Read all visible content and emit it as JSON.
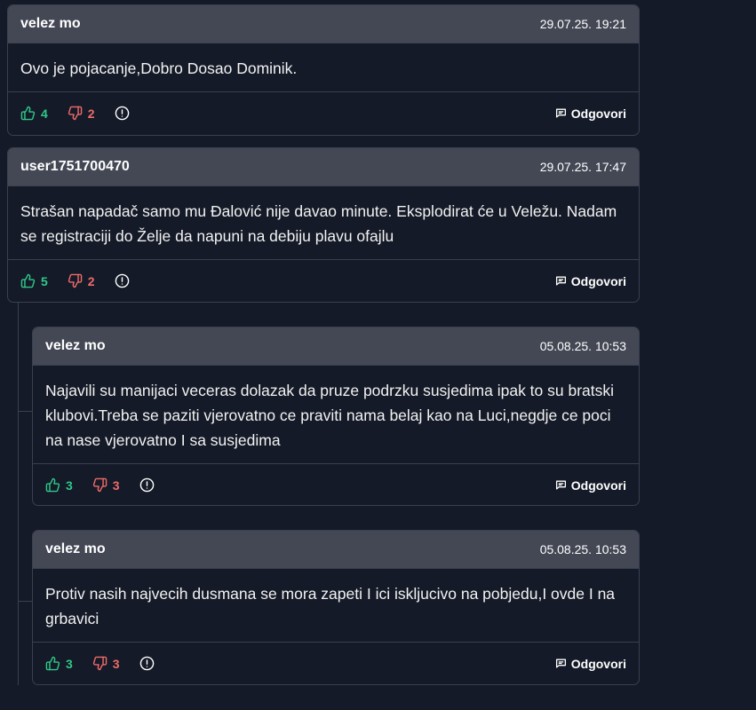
{
  "comments": [
    {
      "user": "velez mo",
      "time": "29.07.25. 19:21",
      "text": "Ovo je pojacanje,Dobro Dosao Dominik.",
      "likes": "4",
      "dislikes": "2",
      "reply_label": "Odgovori"
    },
    {
      "user": "user1751700470",
      "time": "29.07.25. 17:47",
      "text": "Strašan napadač samo mu Đalović nije davao minute. Eksplodirat će u Veležu. Nadam se registraciji do Želje da napuni na debiju plavu ofajlu",
      "likes": "5",
      "dislikes": "2",
      "reply_label": "Odgovori"
    },
    {
      "user": "velez mo",
      "time": "05.08.25. 10:53",
      "text": "Najavili su manijaci veceras dolazak da pruze podrzku susjedima ipak to su bratski klubovi.Treba se paziti vjerovatno ce praviti nama belaj kao na Luci,negdje ce poci na nase vjerovatno I sa susjedima",
      "likes": "3",
      "dislikes": "3",
      "reply_label": "Odgovori"
    },
    {
      "user": "velez mo",
      "time": "05.08.25. 10:53",
      "text": "Protiv nasih najvecih dusmana se mora zapeti I ici iskljucivo na pobjedu,I ovde I na grbavici",
      "likes": "3",
      "dislikes": "3",
      "reply_label": "Odgovori"
    }
  ],
  "colors": {
    "background": "#141a27",
    "header": "#444855",
    "border": "#3a4050",
    "like": "#2ec98a",
    "dislike": "#ef6b6b"
  },
  "icons": {
    "like": "thumbs-up-icon",
    "dislike": "thumbs-down-icon",
    "report": "alert-circle-icon",
    "reply": "message-icon"
  }
}
